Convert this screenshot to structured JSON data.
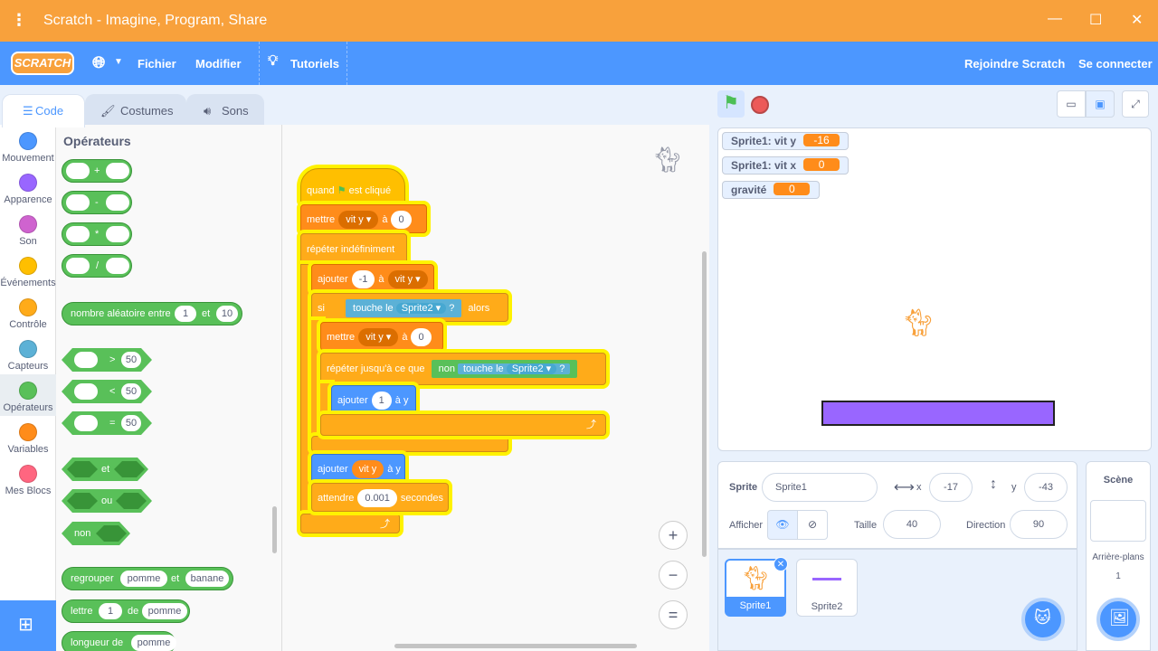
{
  "window": {
    "title": "Scratch - Imagine, Program, Share",
    "menu_icon": "kebab-menu-icon",
    "controls": [
      "minimize-icon",
      "maximize-icon",
      "close-icon"
    ]
  },
  "menubar": {
    "logo": "SCRATCH",
    "language_icon": "globe-icon",
    "file": "Fichier",
    "edit": "Modifier",
    "tutorials": "Tutoriels",
    "join": "Rejoindre Scratch",
    "signin": "Se connecter"
  },
  "tabs": {
    "code": "Code",
    "costumes": "Costumes",
    "sounds": "Sons"
  },
  "categories": [
    {
      "label": "Mouvement",
      "color": "#4c97ff"
    },
    {
      "label": "Apparence",
      "color": "#9966ff"
    },
    {
      "label": "Son",
      "color": "#cf63cf"
    },
    {
      "label": "Événements",
      "color": "#ffbf00"
    },
    {
      "label": "Contrôle",
      "color": "#ffab19"
    },
    {
      "label": "Capteurs",
      "color": "#5cb1d6"
    },
    {
      "label": "Opérateurs",
      "color": "#59c059"
    },
    {
      "label": "Variables",
      "color": "#ff8c1a"
    },
    {
      "label": "Mes Blocs",
      "color": "#ff6680"
    }
  ],
  "palette": {
    "heading": "Opérateurs",
    "arith": [
      "+",
      "-",
      "*",
      "/"
    ],
    "random": {
      "label": "nombre aléatoire entre",
      "from": "1",
      "and": "et",
      "to": "10"
    },
    "compare": [
      {
        "op": ">",
        "val": "50"
      },
      {
        "op": "<",
        "val": "50"
      },
      {
        "op": "=",
        "val": "50"
      }
    ],
    "logic": {
      "and": "et",
      "or": "ou",
      "not": "non"
    },
    "join": {
      "label": "regrouper",
      "a": "pomme",
      "and": "et",
      "b": "banane"
    },
    "letter": {
      "label": "lettre",
      "n": "1",
      "of": "de",
      "word": "pomme"
    },
    "length": {
      "label": "longueur de",
      "word": "pomme"
    }
  },
  "script": {
    "hat": {
      "when": "quand",
      "clicked": "est cliqué"
    },
    "set1": {
      "label": "mettre",
      "var": "vit y",
      "to": "à",
      "val": "0"
    },
    "forever": "répéter indéfiniment",
    "change1": {
      "label": "ajouter",
      "val": "-1",
      "to": "à",
      "var": "vit y"
    },
    "if": {
      "label": "si",
      "touching": "touche le",
      "sprite": "Sprite2",
      "q": "?",
      "then": "alors"
    },
    "set2": {
      "label": "mettre",
      "var": "vit y",
      "to": "à",
      "val": "0"
    },
    "until": {
      "label": "répéter jusqu'à ce que",
      "not": "non",
      "touching": "touche le",
      "sprite": "Sprite2",
      "q": "?"
    },
    "changey1": {
      "label": "ajouter",
      "val": "1",
      "to": "à y"
    },
    "changey2": {
      "label": "ajouter",
      "var": "vit y",
      "to": "à y"
    },
    "wait": {
      "label": "attendre",
      "val": "0.001",
      "unit": "secondes"
    },
    "zoom": {
      "in": "+",
      "out": "−",
      "reset": "="
    }
  },
  "monitors": [
    {
      "label": "Sprite1: vit y",
      "value": "-16"
    },
    {
      "label": "Sprite1: vit x",
      "value": "0"
    },
    {
      "label": "gravité",
      "value": "0"
    }
  ],
  "stage_colors": {
    "platform": "#9966ff",
    "accent": "#4c97ff"
  },
  "sprite_info": {
    "sprite_label": "Sprite",
    "name": "Sprite1",
    "x_label": "x",
    "x": "-17",
    "y_label": "y",
    "y": "-43",
    "show_label": "Afficher",
    "size_label": "Taille",
    "size": "40",
    "direction_label": "Direction",
    "direction": "90"
  },
  "sprites": [
    {
      "name": "Sprite1"
    },
    {
      "name": "Sprite2"
    }
  ],
  "scene": {
    "title": "Scène",
    "backdrops_label": "Arrière-plans",
    "backdrops_count": "1"
  }
}
